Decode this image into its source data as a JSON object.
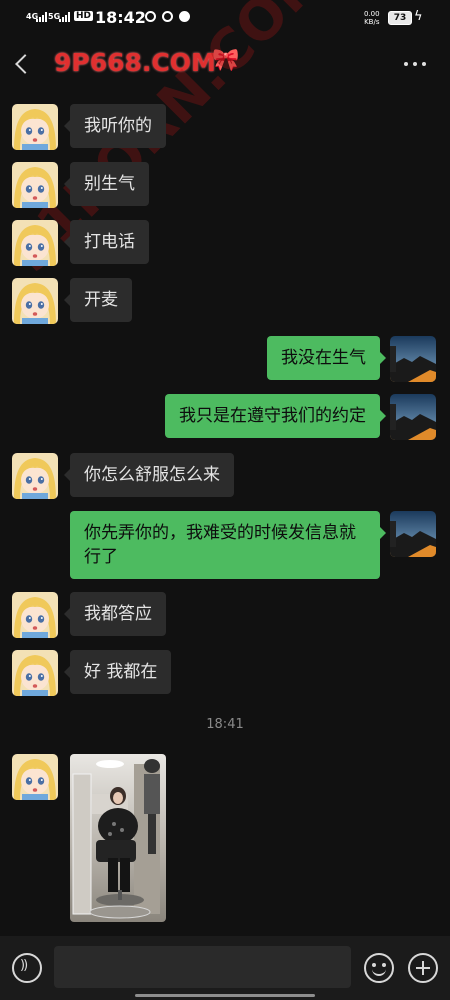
{
  "status_bar": {
    "net1": "4G",
    "net2": "5G",
    "hd": "HD",
    "time": "18:42",
    "speed_value": "0.00",
    "speed_unit": "KB/s",
    "battery": "73"
  },
  "header": {
    "title": "9P668.COM",
    "bow": "🎀",
    "watermark": "91PORN.COM"
  },
  "messages": [
    {
      "side": "left",
      "text": "我听你的"
    },
    {
      "side": "left",
      "text": "别生气"
    },
    {
      "side": "left",
      "text": "打电话"
    },
    {
      "side": "left",
      "text": "开麦"
    },
    {
      "side": "right",
      "text": "我没在生气"
    },
    {
      "side": "right",
      "text": "我只是在遵守我们的约定"
    },
    {
      "side": "left",
      "text": "你怎么舒服怎么来"
    },
    {
      "side": "right",
      "text": "你先弄你的，我难受的时候发信息就行了"
    },
    {
      "side": "left",
      "text": "我都答应"
    },
    {
      "side": "left",
      "text": "好 我都在"
    }
  ],
  "timestamp": "18:41",
  "input": {
    "placeholder": ""
  },
  "colors": {
    "outgoing_bubble": "#4dbb60",
    "incoming_bubble": "#2c2c2c",
    "title": "#e03030",
    "background": "#111111"
  }
}
